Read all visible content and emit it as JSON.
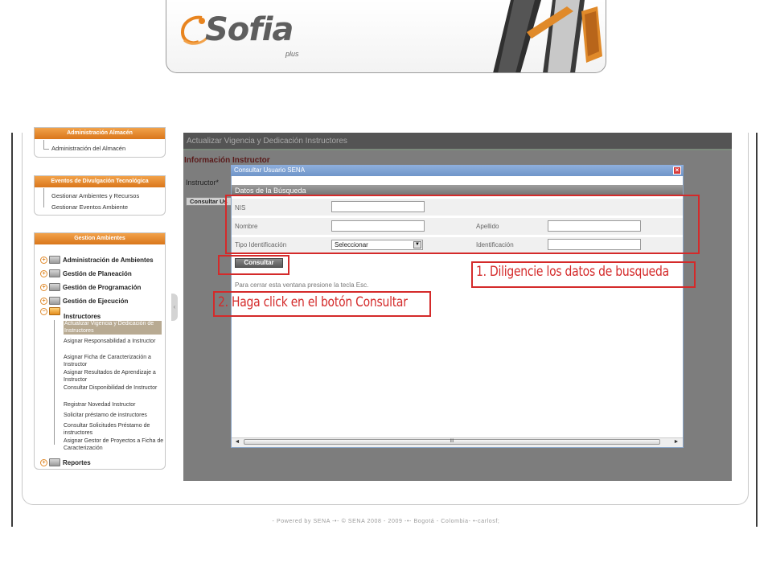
{
  "brand": {
    "logo_text": "Sofia",
    "logo_sub": "plus"
  },
  "sidebar": {
    "box1": {
      "header": "Administración Almacén",
      "items": [
        "Administración del Almacén"
      ]
    },
    "box2": {
      "header": "Eventos de Divulgación Tecnológica",
      "items": [
        "Gestionar Ambientes y Recursos",
        "Gestionar Eventos Ambiente"
      ]
    },
    "box3": {
      "header": "Gestion Ambientes",
      "menus": [
        "Administración de Ambientes",
        "Gestión de Planeación",
        "Gestión de Programación",
        "Gestión de Ejecución"
      ],
      "submenu": "Instructores",
      "leaves": [
        "Actualizar Vigencia y Dedicación de Instructores",
        "Asignar Responsabilidad a Instructor",
        "Asignar Ficha de Caracterización a Instructor",
        "Asignar Resultados de Aprendizaje a Instructor",
        "Consultar Disponibilidad de Instructor",
        "Registrar Novedad Instructor",
        "Solicitar préstamo de instructores",
        "Consultar Solicitudes Préstamo de instructores",
        "Asignar Gestor de Proyectos a Ficha de Caracterización"
      ],
      "last_menu": "Reportes"
    }
  },
  "main": {
    "title": "Actualizar Vigencia y Dedicación Instructores",
    "section": "Información Instructor",
    "instructor_label": "Instructor*",
    "consultar_label": "Consultar Us"
  },
  "modal": {
    "title": "Consultar Usuario SENA",
    "close": "×",
    "section_header": "Datos de la Búsqueda",
    "fields": {
      "nis": "NIS",
      "nombre": "Nombre",
      "apellido": "Apellido",
      "tipo_identificacion": "Tipo Identificación",
      "tipo_value": "Seleccionar",
      "identificacion": "Identificación"
    },
    "button": "Consultar",
    "hint": "Para cerrar esta ventana presione la tecla Esc.",
    "scroll_thumb": "III"
  },
  "annotations": {
    "step1": "1. Diligencie los datos de busqueda",
    "step2": "2. Haga click en el botón Consultar",
    "color": "#d42a2a"
  },
  "footer": "- Powered by SENA -•- © SENA 2008 - 2009 -•- Bogotá - Colombia- •-carlosf;"
}
